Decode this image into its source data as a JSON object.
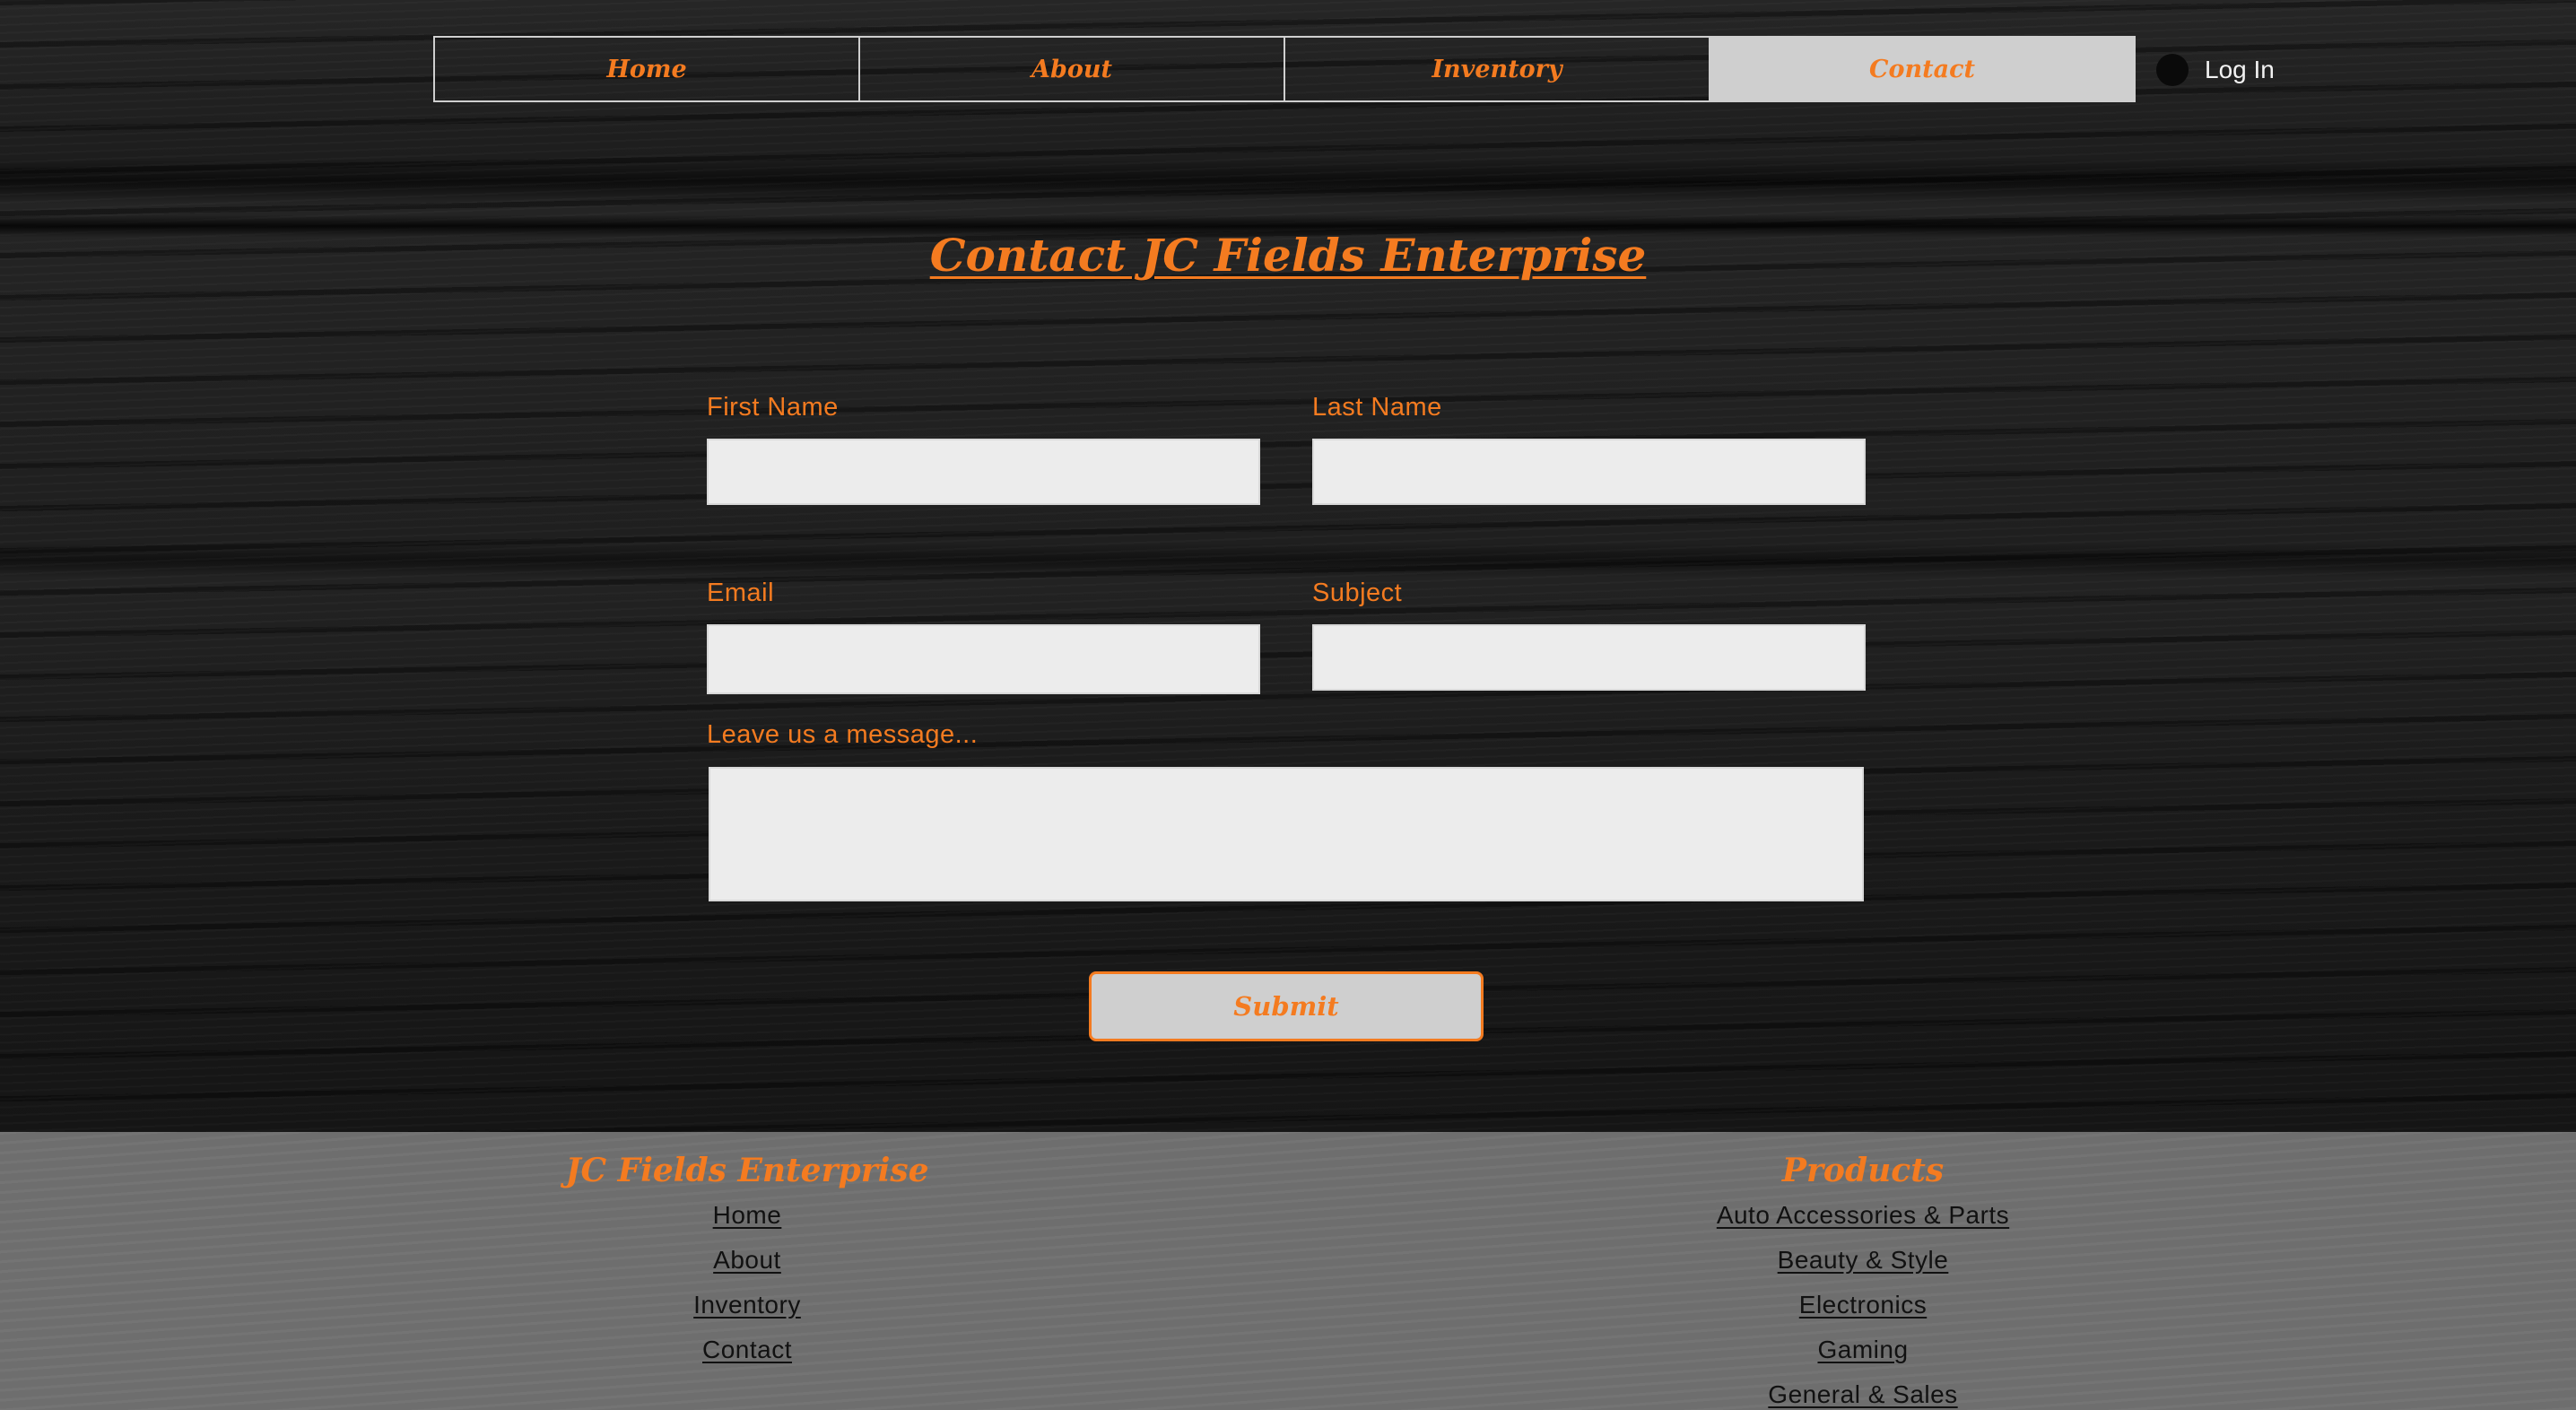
{
  "nav": {
    "items": [
      {
        "label": "Home"
      },
      {
        "label": "About"
      },
      {
        "label": "Inventory"
      },
      {
        "label": "Contact"
      }
    ],
    "active": "Contact",
    "login_label": "Log In"
  },
  "page": {
    "title": "Contact JC Fields Enterprise"
  },
  "form": {
    "first_name_label": "First Name",
    "first_name_value": "",
    "last_name_label": "Last Name",
    "last_name_value": "",
    "email_label": "Email",
    "email_value": "",
    "subject_label": "Subject",
    "subject_value": "",
    "message_label": "Leave us a message...",
    "message_value": "",
    "submit_label": "Submit"
  },
  "footer": {
    "company": {
      "heading": "JC Fields Enterprise",
      "links": [
        "Home",
        "About",
        "Inventory",
        "Contact"
      ]
    },
    "products": {
      "heading": "Products",
      "links": [
        "Auto Accessories & Parts",
        "Beauty & Style",
        "Electronics",
        "Gaming",
        "General & Sales"
      ]
    }
  },
  "colors": {
    "accent": "#f47b20",
    "nav_active_bg": "#cfcfcf",
    "footer_bg": "#6e6e6e",
    "field_bg": "#ececec"
  }
}
